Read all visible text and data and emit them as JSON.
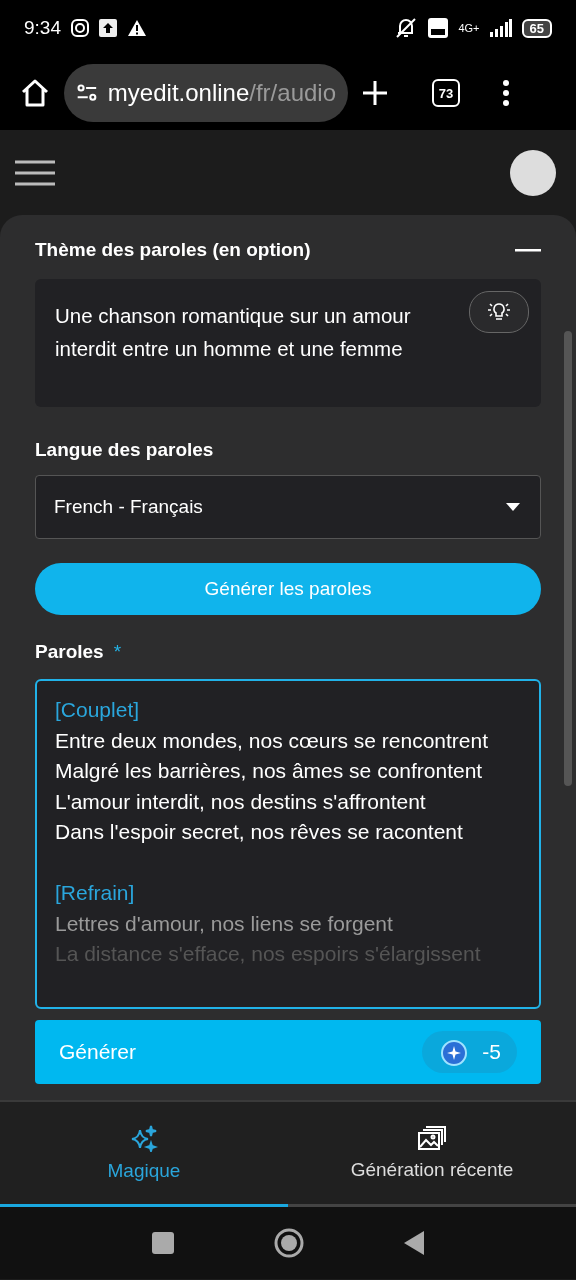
{
  "status_bar": {
    "time": "9:34",
    "network": "4G+",
    "battery": "65"
  },
  "browser": {
    "url_host": "myedit.online",
    "url_path": "/fr/audio",
    "tab_count": "73"
  },
  "theme": {
    "title": "Thème des paroles (en option)",
    "text": "Une chanson romantique sur un amour interdit entre un homme et une femme"
  },
  "language": {
    "label": "Langue des paroles",
    "value": "French - Français"
  },
  "generate_lyrics_button": "Générer les paroles",
  "lyrics": {
    "label": "Paroles",
    "required_mark": "*",
    "lines": [
      {
        "kind": "section",
        "text": "[Couplet]"
      },
      {
        "kind": "line",
        "text": "Entre deux mondes, nos cœurs se rencontrent"
      },
      {
        "kind": "line",
        "text": "Malgré les barrières, nos âmes se confrontent"
      },
      {
        "kind": "line",
        "text": "L'amour interdit, nos destins s'affrontent"
      },
      {
        "kind": "line",
        "text": "Dans l'espoir secret, nos rêves se racontent"
      },
      {
        "kind": "blank"
      },
      {
        "kind": "section",
        "text": "[Refrain]"
      },
      {
        "kind": "fading",
        "text": "Lettres d'amour, nos liens se forgent"
      },
      {
        "kind": "faded",
        "text": "La distance s'efface, nos espoirs s'élargissent"
      }
    ]
  },
  "generate_button": {
    "label": "Générer",
    "cost": "-5"
  },
  "tabs": [
    {
      "label": "Magique",
      "selected": true
    },
    {
      "label": "Génération récente",
      "selected": false
    }
  ]
}
